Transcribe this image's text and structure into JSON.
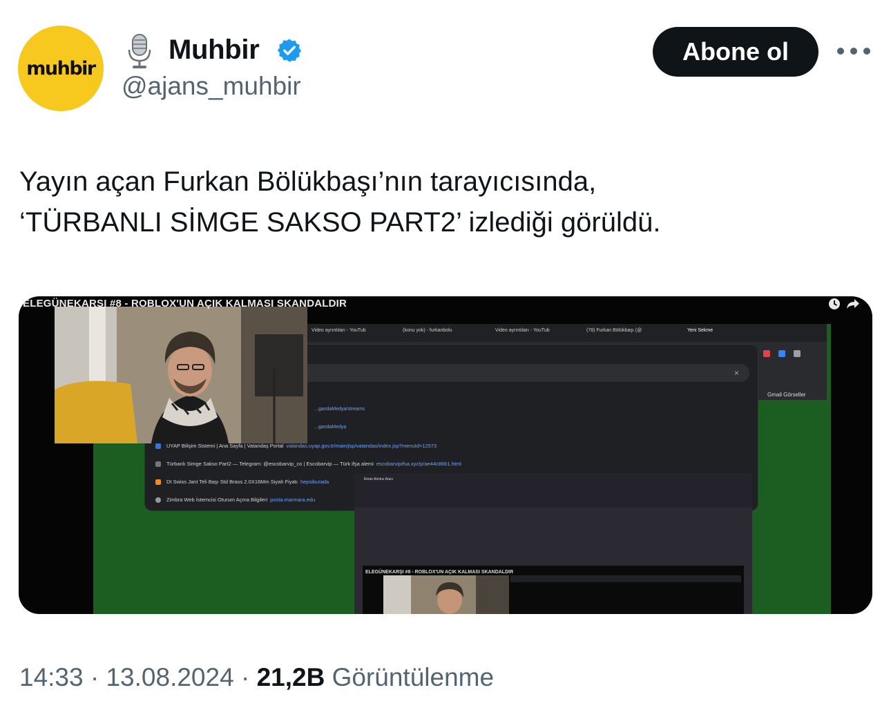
{
  "author": {
    "avatar_text": "muhbir",
    "display_name": "Muhbir",
    "handle": "@ajans_muhbir",
    "avatar_color": "#f7c81e",
    "verified_color": "#1d9bf0"
  },
  "actions": {
    "follow_label": "Abone ol"
  },
  "tweet": {
    "line1": "Yayın açan Furkan Bölükbaşı’nın tarayıcısında,",
    "line2": "‘TÜRBANLI SİMGE SAKSO PART2’ izlediği görüldü."
  },
  "media": {
    "video_title": "ELEGÜNEKARŞI #8 - ROBLOX'UN AÇIK KALMASI SKANDALDIR",
    "tabs": [
      "Video ayrıntıları - YouTub",
      "(konu yok) - furkanbolu",
      "Video ayrıntıları - YouTub",
      "(78) Furkan Bölükbaşı (@",
      "Yeni Sekme"
    ],
    "gmail_links": "Gmail   Görseller",
    "dropdown_links": [
      "...gandaMedya/streams",
      "...gandaMedya"
    ],
    "suggestions": [
      {
        "text": "UYAP Bilişim Sistemi | Ana Sayfa | Vatandaş Portal",
        "url": "vatandas.uyap.gov.tr/main/jsp/vatandas/index.jsp?menuId=12573"
      },
      {
        "text": "Türbanlı Simge Sakso Part2 — Telegram: @escobarvip_co | Escobarvip — Türk ifşa alemi",
        "url": "escobarvipifsa.xyz/p/ae44c86b1.html"
      },
      {
        "text": "Dt Swiss Jant Teli Başı Std Brass 2.0X16Mm Siyah Fiyatı",
        "url": "hepsiburada"
      },
      {
        "text": "Zimbra Web İstemcisi Oturum Açma Bilgileri",
        "url": "posta.marmara.edu"
      }
    ],
    "recorder_title": "Ekran Alıntısı Aracı",
    "nested_title": "ELEGÜNEKARŞI #8 - ROBLOX'UN AÇIK KALMASI SKANDALDIR"
  },
  "footer": {
    "time": "14:33",
    "separator": "·",
    "date": "13.08.2024",
    "views_count": "21,2B",
    "views_label": "Görüntülenme"
  }
}
